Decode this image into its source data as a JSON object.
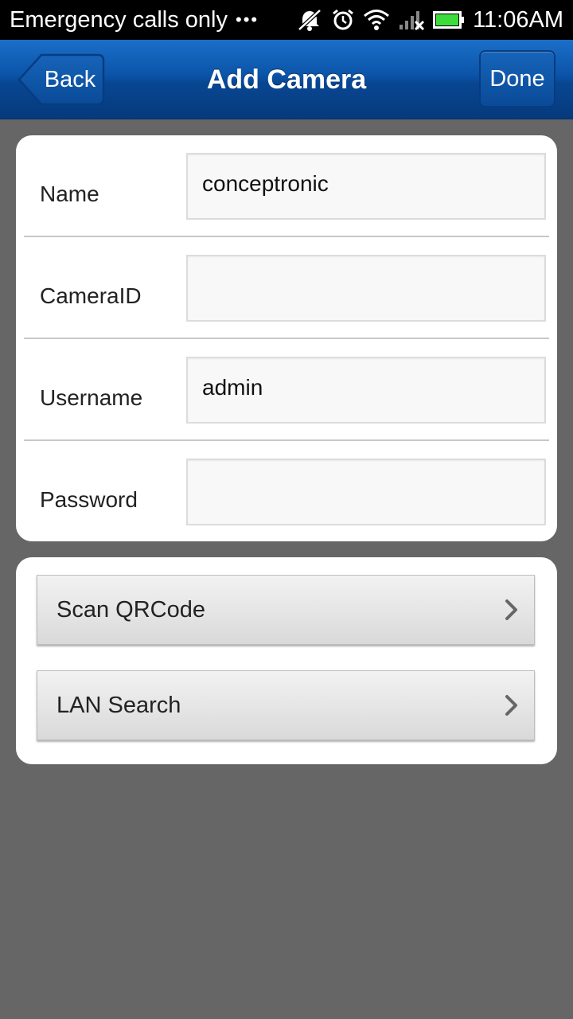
{
  "status_bar": {
    "carrier_text": "Emergency calls only",
    "dots": "•••",
    "time": "11:06AM",
    "icons": [
      "notifications-off-icon",
      "alarm-icon",
      "wifi-icon",
      "signal-no-sim-icon",
      "battery-icon"
    ],
    "battery_color": "#3ddc3d"
  },
  "nav": {
    "title": "Add Camera",
    "back_label": "Back",
    "done_label": "Done",
    "accent": "#0b54a8"
  },
  "form": {
    "fields": [
      {
        "label": "Name",
        "value": "conceptronic"
      },
      {
        "label": "CameraID",
        "value": ""
      },
      {
        "label": "Username",
        "value": "admin"
      },
      {
        "label": "Password",
        "value": ""
      }
    ]
  },
  "actions": [
    {
      "label": "Scan QRCode",
      "icon": "chevron-right-icon"
    },
    {
      "label": "LAN Search",
      "icon": "chevron-right-icon"
    }
  ]
}
